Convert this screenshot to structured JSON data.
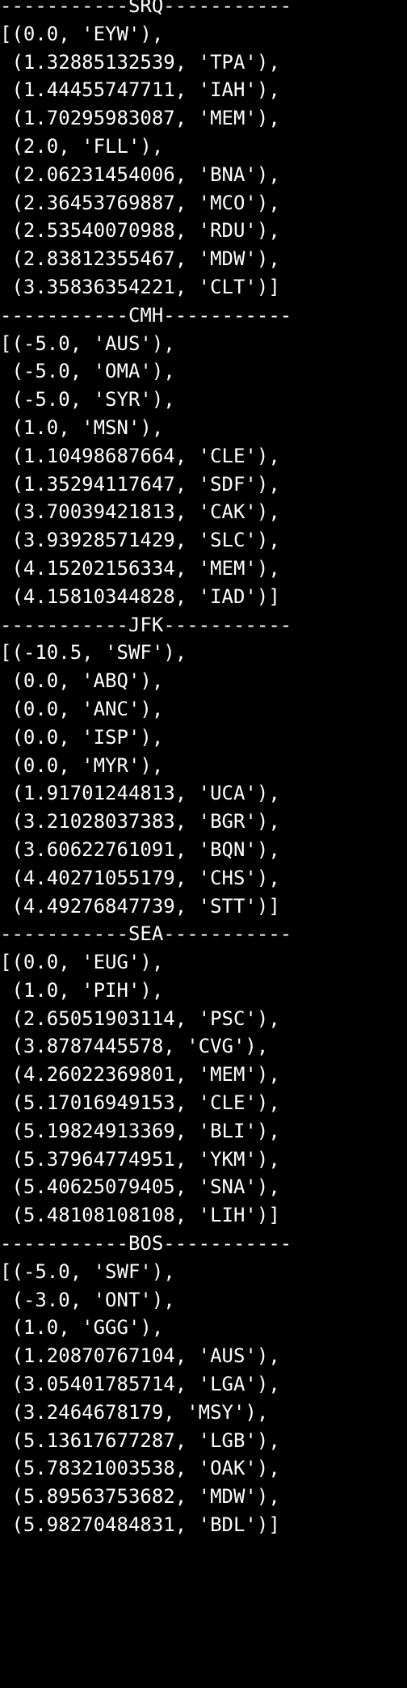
{
  "theme": {
    "background": "#000000",
    "foreground": "#ffffff"
  },
  "lines": [
    "-----------SRQ-----------",
    "[(0.0, 'EYW'),",
    " (1.32885132539, 'TPA'),",
    " (1.44455747711, 'IAH'),",
    " (1.70295983087, 'MEM'),",
    " (2.0, 'FLL'),",
    " (2.06231454006, 'BNA'),",
    " (2.36453769887, 'MCO'),",
    " (2.53540070988, 'RDU'),",
    " (2.83812355467, 'MDW'),",
    " (3.35836354221, 'CLT')]",
    "-----------CMH-----------",
    "[(-5.0, 'AUS'),",
    " (-5.0, 'OMA'),",
    " (-5.0, 'SYR'),",
    " (1.0, 'MSN'),",
    " (1.10498687664, 'CLE'),",
    " (1.35294117647, 'SDF'),",
    " (3.70039421813, 'CAK'),",
    " (3.93928571429, 'SLC'),",
    " (4.15202156334, 'MEM'),",
    " (4.15810344828, 'IAD')]",
    "-----------JFK-----------",
    "[(-10.5, 'SWF'),",
    " (0.0, 'ABQ'),",
    " (0.0, 'ANC'),",
    " (0.0, 'ISP'),",
    " (0.0, 'MYR'),",
    " (1.91701244813, 'UCA'),",
    " (3.21028037383, 'BGR'),",
    " (3.60622761091, 'BQN'),",
    " (4.40271055179, 'CHS'),",
    " (4.49276847739, 'STT')]",
    "-----------SEA-----------",
    "[(0.0, 'EUG'),",
    " (1.0, 'PIH'),",
    " (2.65051903114, 'PSC'),",
    " (3.8787445578, 'CVG'),",
    " (4.26022369801, 'MEM'),",
    " (5.17016949153, 'CLE'),",
    " (5.19824913369, 'BLI'),",
    " (5.37964774951, 'YKM'),",
    " (5.40625079405, 'SNA'),",
    " (5.48108108108, 'LIH')]",
    "-----------BOS-----------",
    "[(-5.0, 'SWF'),",
    " (-3.0, 'ONT'),",
    " (1.0, 'GGG'),",
    " (1.20870767104, 'AUS'),",
    " (3.05401785714, 'LGA'),",
    " (3.2464678179, 'MSY'),",
    " (5.13617677287, 'LGB'),",
    " (5.78321003538, 'OAK'),",
    " (5.89563753682, 'MDW'),",
    " (5.98270484831, 'BDL')]"
  ]
}
